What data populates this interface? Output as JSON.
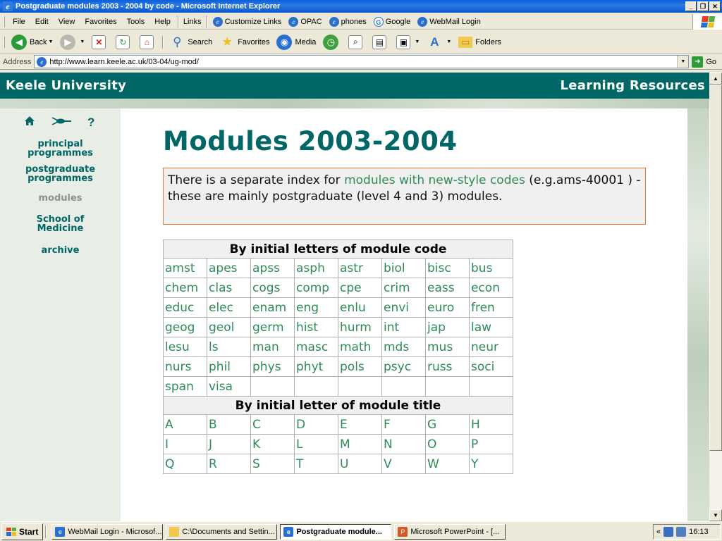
{
  "window": {
    "title": "Postgraduate modules 2003 - 2004 by code - Microsoft Internet Explorer",
    "controls": {
      "minimize": "_",
      "maximize": "❐",
      "close": "✕"
    }
  },
  "menu": {
    "items": [
      "File",
      "Edit",
      "View",
      "Favorites",
      "Tools",
      "Help"
    ],
    "links_label": "Links",
    "links": [
      "Customize Links",
      "OPAC",
      "phones",
      "Google",
      "WebMail Login"
    ]
  },
  "toolbar": {
    "back": "Back",
    "search": "Search",
    "favorites": "Favorites",
    "media": "Media",
    "folders": "Folders"
  },
  "address": {
    "label": "Address",
    "url": "http://www.learn.keele.ac.uk/03-04/ug-mod/",
    "go": "Go"
  },
  "site": {
    "brand_left": "Keele University",
    "brand_right": "Learning Resources",
    "sidebar_icons": [
      "home-icon",
      "insect-icon",
      "help-icon"
    ],
    "help_glyph": "?",
    "nav": [
      {
        "line1": "principal",
        "line2": "programmes"
      },
      {
        "line1": "postgraduate",
        "line2": "programmes"
      },
      {
        "line1": "modules",
        "line2": ""
      },
      {
        "line1": "School of",
        "line2": "Medicine"
      },
      {
        "line1": "archive",
        "line2": ""
      }
    ]
  },
  "main": {
    "title": "Modules 2003-2004",
    "notice": {
      "before": "There is a separate index for ",
      "link": "modules with new-style codes",
      "after": " (e.g.ams-40001 ) - these are mainly postgraduate (level 4 and 3) modules."
    },
    "code_header": "By initial letters of module code",
    "codes": [
      [
        "amst",
        "apes",
        "apss",
        "asph",
        "astr",
        "biol",
        "bisc",
        "bus"
      ],
      [
        "chem",
        "clas",
        "cogs",
        "comp",
        "cpe",
        "crim",
        "eass",
        "econ"
      ],
      [
        "educ",
        "elec",
        "enam",
        "eng",
        "enlu",
        "envi",
        "euro",
        "fren"
      ],
      [
        "geog",
        "geol",
        "germ",
        "hist",
        "hurm",
        "int",
        "jap",
        "law"
      ],
      [
        "lesu",
        "ls",
        "man",
        "masc",
        "math",
        "mds",
        "mus",
        "neur"
      ],
      [
        "nurs",
        "phil",
        "phys",
        "phyt",
        "pols",
        "psyc",
        "russ",
        "soci"
      ],
      [
        "span",
        "visa",
        "",
        "",
        "",
        "",
        "",
        ""
      ]
    ],
    "title_header": "By initial letter of module title",
    "letters": [
      [
        "A",
        "B",
        "C",
        "D",
        "E",
        "F",
        "G",
        "H"
      ],
      [
        "I",
        "J",
        "K",
        "L",
        "M",
        "N",
        "O",
        "P"
      ],
      [
        "Q",
        "R",
        "S",
        "T",
        "U",
        "V",
        "W",
        "Y"
      ]
    ]
  },
  "taskbar": {
    "start": "Start",
    "tasks": [
      {
        "label": "WebMail Login - Microsof...",
        "icon": "ie-icon",
        "active": false
      },
      {
        "label": "C:\\Documents and Settin...",
        "icon": "folder-icon",
        "active": false
      },
      {
        "label": "Postgraduate module...",
        "icon": "ie-icon",
        "active": true
      },
      {
        "label": "Microsoft PowerPoint - [...",
        "icon": "powerpoint-icon",
        "active": false
      }
    ],
    "tray_chevron": "«",
    "clock": "16:13"
  }
}
